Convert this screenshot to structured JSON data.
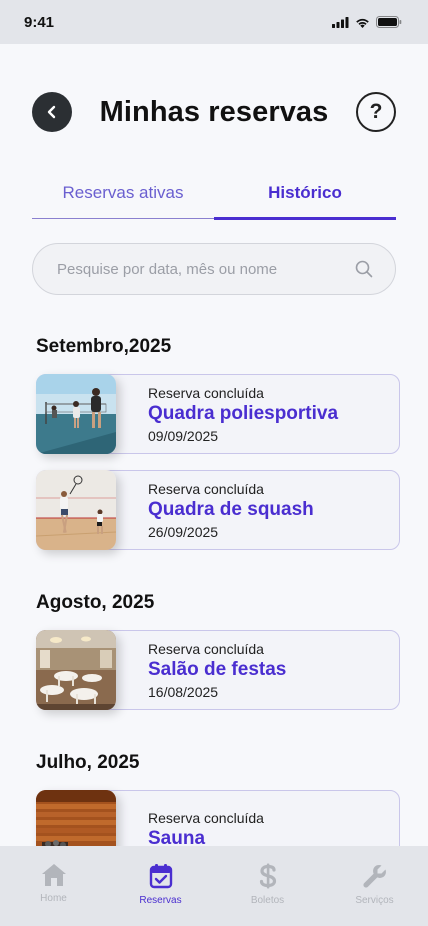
{
  "status_bar": {
    "time": "9:41"
  },
  "header": {
    "title": "Minhas reservas",
    "help_label": "?"
  },
  "tabs": [
    {
      "label": "Reservas ativas",
      "active": false
    },
    {
      "label": "Histórico",
      "active": true
    }
  ],
  "search": {
    "placeholder": "Pesquise por data, mês ou nome",
    "value": ""
  },
  "sections": [
    {
      "title": "Setembro,2025",
      "items": [
        {
          "status": "Reserva concluída",
          "name": "Quadra poliesportiva",
          "date": "09/09/2025"
        },
        {
          "status": "Reserva concluída",
          "name": "Quadra de squash",
          "date": "26/09/2025"
        }
      ]
    },
    {
      "title": "Agosto, 2025",
      "items": [
        {
          "status": "Reserva concluída",
          "name": "Salão de festas",
          "date": "16/08/2025"
        }
      ]
    },
    {
      "title": "Julho, 2025",
      "items": [
        {
          "status": "Reserva concluída",
          "name": "Sauna",
          "date": ""
        }
      ]
    }
  ],
  "bottom_nav": [
    {
      "label": "Home",
      "icon": "home-icon",
      "active": false
    },
    {
      "label": "Reservas",
      "icon": "calendar-check-icon",
      "active": true
    },
    {
      "label": "Boletos",
      "icon": "dollar-icon",
      "active": false
    },
    {
      "label": "Serviços",
      "icon": "wrench-icon",
      "active": false
    }
  ],
  "colors": {
    "accent": "#4a2ed0",
    "background": "#f7f8fb",
    "nav_background": "#e3e5ea"
  }
}
